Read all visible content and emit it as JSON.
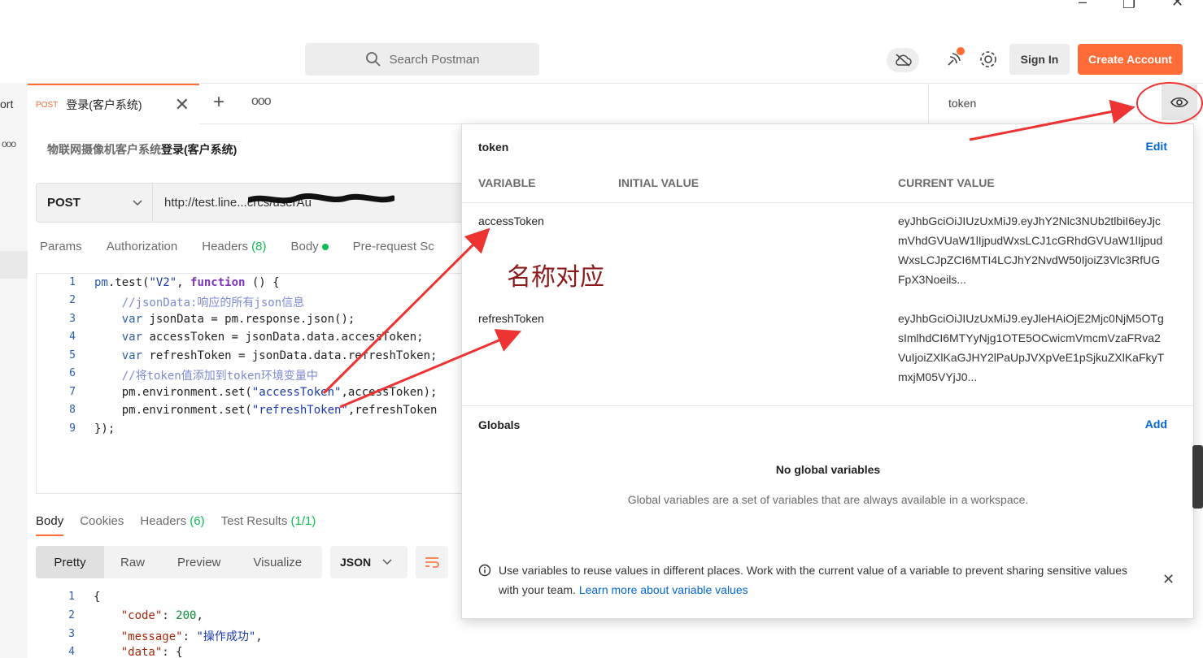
{
  "header": {
    "search_placeholder": "Search Postman",
    "sign_in": "Sign In",
    "create_account": "Create Account"
  },
  "left": {
    "cut_label": "ort",
    "more": "ooo"
  },
  "tab": {
    "method": "POST",
    "title": "登录(客户系统)",
    "more": "ooo"
  },
  "breadcrumb": {
    "a": "物联网摄像机",
    "b": "客户系统",
    "c": "登录(客户系统)"
  },
  "request": {
    "method": "POST",
    "url": "http://test.line...crcs/userAu",
    "tabs": {
      "params": "Params",
      "auth": "Authorization",
      "headers": "Headers",
      "headers_count": "(8)",
      "body": "Body",
      "prereq": "Pre-request Sc"
    }
  },
  "code": {
    "line_numbers": [
      "1",
      "2",
      "3",
      "4",
      "5",
      "6",
      "7",
      "8",
      "9"
    ]
  },
  "response": {
    "tabs": {
      "body": "Body",
      "cookies": "Cookies",
      "headers": "Headers",
      "headers_count": "(6)",
      "tests": "Test Results",
      "tests_count": "(1/1)"
    },
    "views": [
      "Pretty",
      "Raw",
      "Preview",
      "Visualize"
    ],
    "format": "JSON",
    "line_numbers": [
      "1",
      "2",
      "3",
      "4"
    ]
  },
  "environment": {
    "selected": "token",
    "name": "token",
    "edit": "Edit",
    "columns": {
      "variable": "VARIABLE",
      "initial": "INITIAL VALUE",
      "current": "CURRENT VALUE"
    },
    "vars": [
      {
        "name": "accessToken",
        "current": "eyJhbGciOiJIUzUxMiJ9.eyJhY2Nlc3NUb2tlbiI6eyJjcmVhdGVUaW1lIjpudWxsLCJ1cGRhdGVUaW1lIjpudWxsLCJpZCI6MTI4LCJhY2NvdW50IjoiZ3Vlc3RfUGFpX3Noeils..."
      },
      {
        "name": "refreshToken",
        "current": "eyJhbGciOiJIUzUxMiJ9.eyJleHAiOjE2Mjc0NjM5OTgsImlhdCI6MTYyNjg1OTE5OCwicmVmcmVzaFRva2VuIjoiZXlKaGJHY2lPaUpJVXpVeE1pSjkuZXlKaFkyTmxjM05VYjJ0..."
      }
    ],
    "globals_title": "Globals",
    "globals_add": "Add",
    "no_globals": "No global variables",
    "globals_desc": "Global variables are a set of variables that are always available in a workspace.",
    "info_text": "Use variables to reuse values in different places. Work with the current value of a variable to prevent sharing sensitive values with your team.",
    "info_link": "Learn more about variable values"
  },
  "annotation": "名称对应",
  "colors": {
    "accent": "#ff6c37",
    "link": "#0265d2",
    "annotation_red": "#ee3333"
  }
}
